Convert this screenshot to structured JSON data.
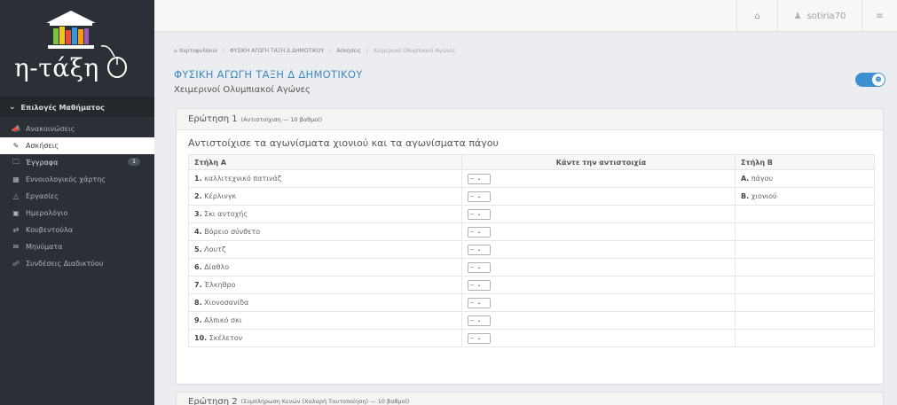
{
  "app": {
    "logo_text": "η-τάξη"
  },
  "sidebar": {
    "section_title": "Επιλογές Μαθήματος",
    "items": [
      {
        "label": "Ανακοινώσεις",
        "icon": "megaphone-icon"
      },
      {
        "label": "Ασκήσεις",
        "icon": "edit-icon",
        "active": true
      },
      {
        "label": "Έγγραφα",
        "icon": "folder-icon",
        "badge": "1"
      },
      {
        "label": "Εννοιολογικός χάρτης",
        "icon": "sitemap-icon"
      },
      {
        "label": "Εργασίες",
        "icon": "flask-icon"
      },
      {
        "label": "Ημερολόγιο",
        "icon": "calendar-icon"
      },
      {
        "label": "Κουβεντούλα",
        "icon": "chat-icon"
      },
      {
        "label": "Μηνύματα",
        "icon": "envelope-icon"
      },
      {
        "label": "Συνδέσεις Διαδικτύου",
        "icon": "link-icon"
      }
    ]
  },
  "topbar": {
    "username": "sotiria70"
  },
  "breadcrumb": [
    "Χαρτοφυλάκιο",
    "ΦΥΣΙΚΗ ΑΓΩΓΗ ΤΑΞΗ Δ ΔΗΜΟΤΙΚΟΥ",
    "Ασκήσεις",
    "Χειμερινοί Ολυμπιακοί Αγώνες"
  ],
  "page": {
    "title": "ΦΥΣΙΚΗ ΑΓΩΓΗ ΤΑΞΗ Δ ΔΗΜΟΤΙΚΟΥ",
    "subtitle": "Χειμερινοί Ολυμπιακοί Αγώνες"
  },
  "question1": {
    "title": "Ερώτηση 1",
    "meta": "(Αντιστοίχιση — 10 βαθμοί)",
    "text": "Αντιστοίχισε τα αγωνίσματα χιονιού και τα αγωνίσματα πάγου",
    "columns": [
      "Στήλη Α",
      "Κάντε την αντιστοιχία",
      "Στήλη Β"
    ],
    "rows": [
      {
        "num": "1.",
        "label": "καλλιτεχνικό πατινάζ",
        "select": "--",
        "b_num": "Α.",
        "b_label": "πάγου"
      },
      {
        "num": "2.",
        "label": "Κέρλινγκ",
        "select": "--",
        "b_num": "Β.",
        "b_label": "χιονιού"
      },
      {
        "num": "3.",
        "label": "Σκι αντοχής",
        "select": "--",
        "b_num": "",
        "b_label": ""
      },
      {
        "num": "4.",
        "label": "Βόρειο σύνθετο",
        "select": "--",
        "b_num": "",
        "b_label": ""
      },
      {
        "num": "5.",
        "label": "Λουτζ",
        "select": "--",
        "b_num": "",
        "b_label": ""
      },
      {
        "num": "6.",
        "label": "Δίαθλο",
        "select": "--",
        "b_num": "",
        "b_label": ""
      },
      {
        "num": "7.",
        "label": "Έλκηθρο",
        "select": "--",
        "b_num": "",
        "b_label": ""
      },
      {
        "num": "8.",
        "label": "Χιονοσανίδα",
        "select": "--",
        "b_num": "",
        "b_label": ""
      },
      {
        "num": "9.",
        "label": "Αλπικό σκι",
        "select": "--",
        "b_num": "",
        "b_label": ""
      },
      {
        "num": "10.",
        "label": "Σκέλετον",
        "select": "--",
        "b_num": "",
        "b_label": ""
      }
    ]
  },
  "question2": {
    "title": "Ερώτηση 2",
    "meta": "(Συμπλήρωση Κενών (Χαλαρή Ταυτοποίηση) — 10 βαθμοί)"
  }
}
